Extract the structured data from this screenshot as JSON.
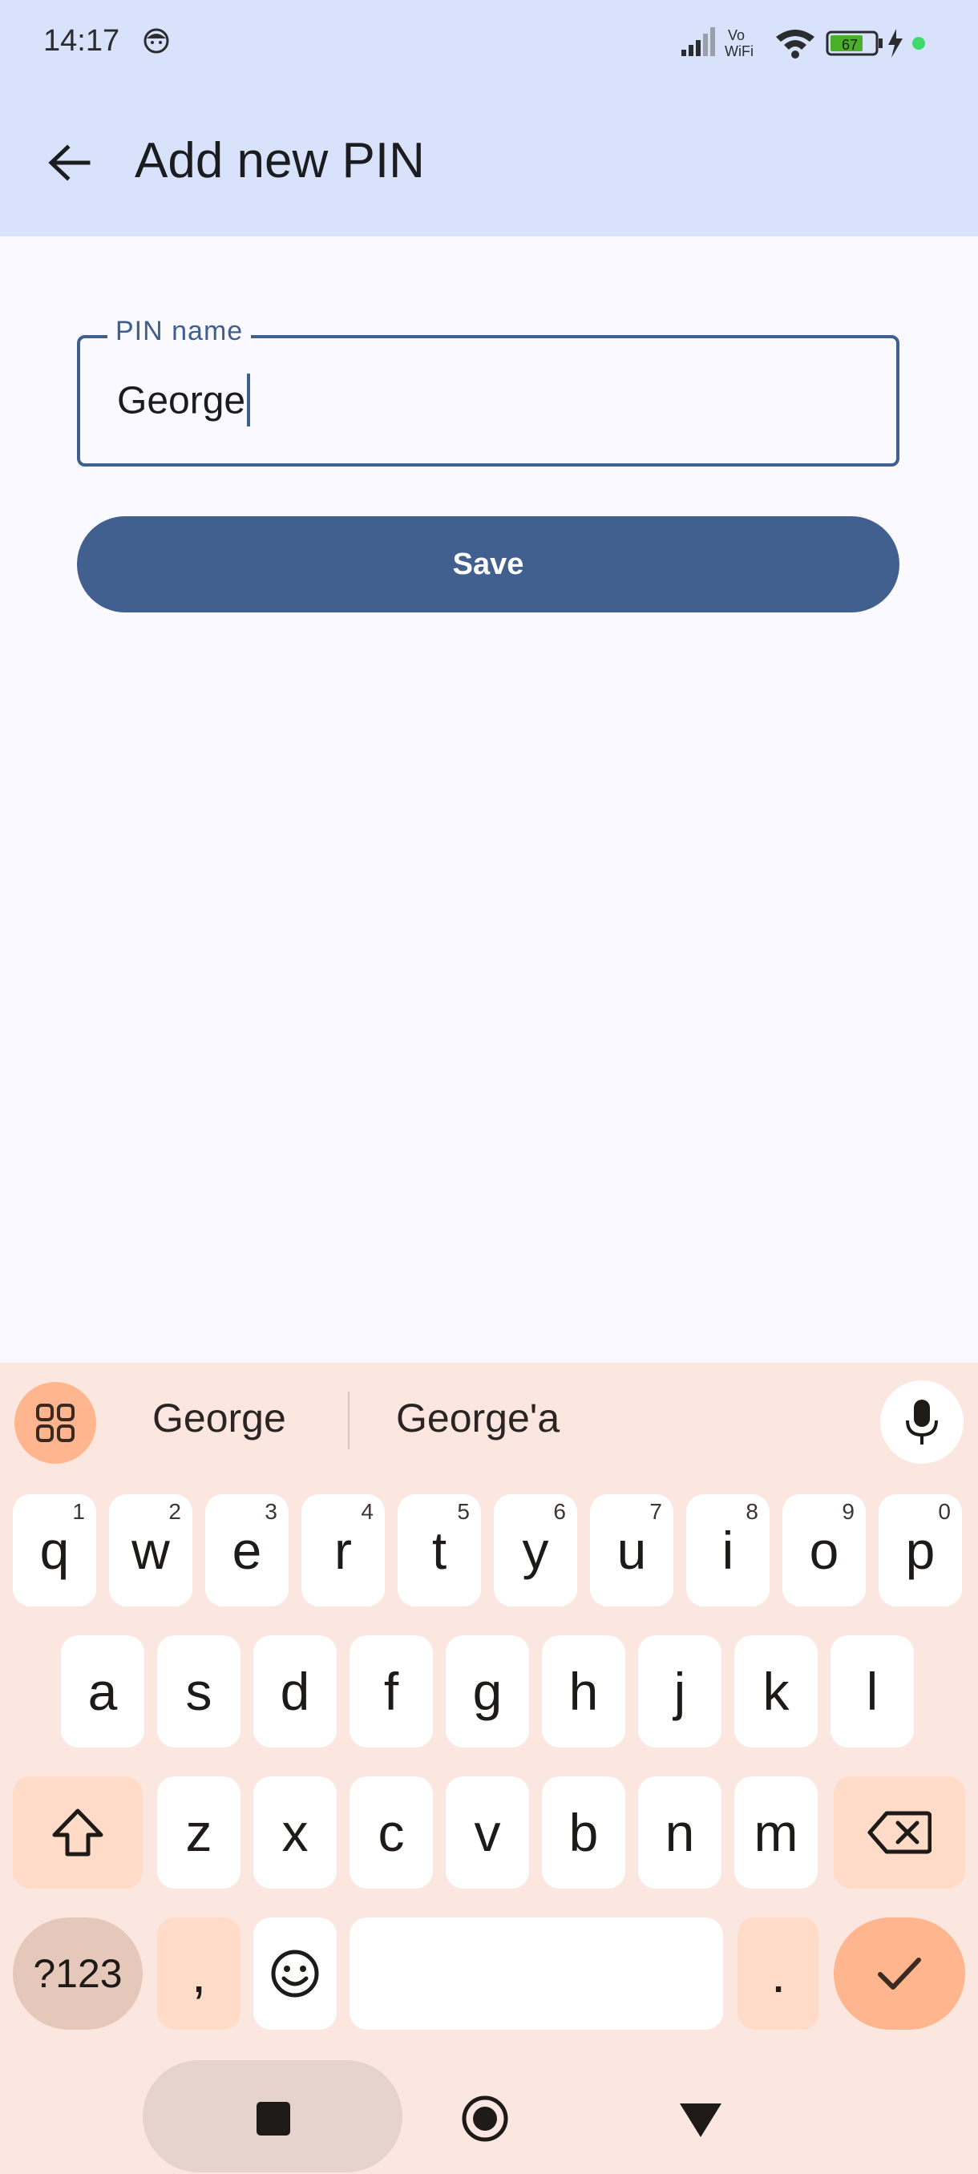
{
  "status_bar": {
    "time": "14:17",
    "vowifi": [
      "Vo",
      "WiFi"
    ],
    "battery": "67"
  },
  "app_bar": {
    "title": "Add new PIN"
  },
  "form": {
    "field_label": "PIN name",
    "field_value": "George",
    "save_label": "Save"
  },
  "keyboard": {
    "suggestions": [
      "George",
      "George'a"
    ],
    "row1": [
      {
        "k": "q",
        "h": "1"
      },
      {
        "k": "w",
        "h": "2"
      },
      {
        "k": "e",
        "h": "3"
      },
      {
        "k": "r",
        "h": "4"
      },
      {
        "k": "t",
        "h": "5"
      },
      {
        "k": "y",
        "h": "6"
      },
      {
        "k": "u",
        "h": "7"
      },
      {
        "k": "i",
        "h": "8"
      },
      {
        "k": "o",
        "h": "9"
      },
      {
        "k": "p",
        "h": "0"
      }
    ],
    "row2": [
      "a",
      "s",
      "d",
      "f",
      "g",
      "h",
      "j",
      "k",
      "l"
    ],
    "row3": [
      "z",
      "x",
      "c",
      "v",
      "b",
      "n",
      "m"
    ],
    "symbols_label": "?123",
    "comma": ",",
    "period": "."
  },
  "colors": {
    "app_bar": "#d8e2fb",
    "primary": "#415f8f",
    "keyboard_bg": "#fbe7e0",
    "accent": "#ffb58e"
  }
}
